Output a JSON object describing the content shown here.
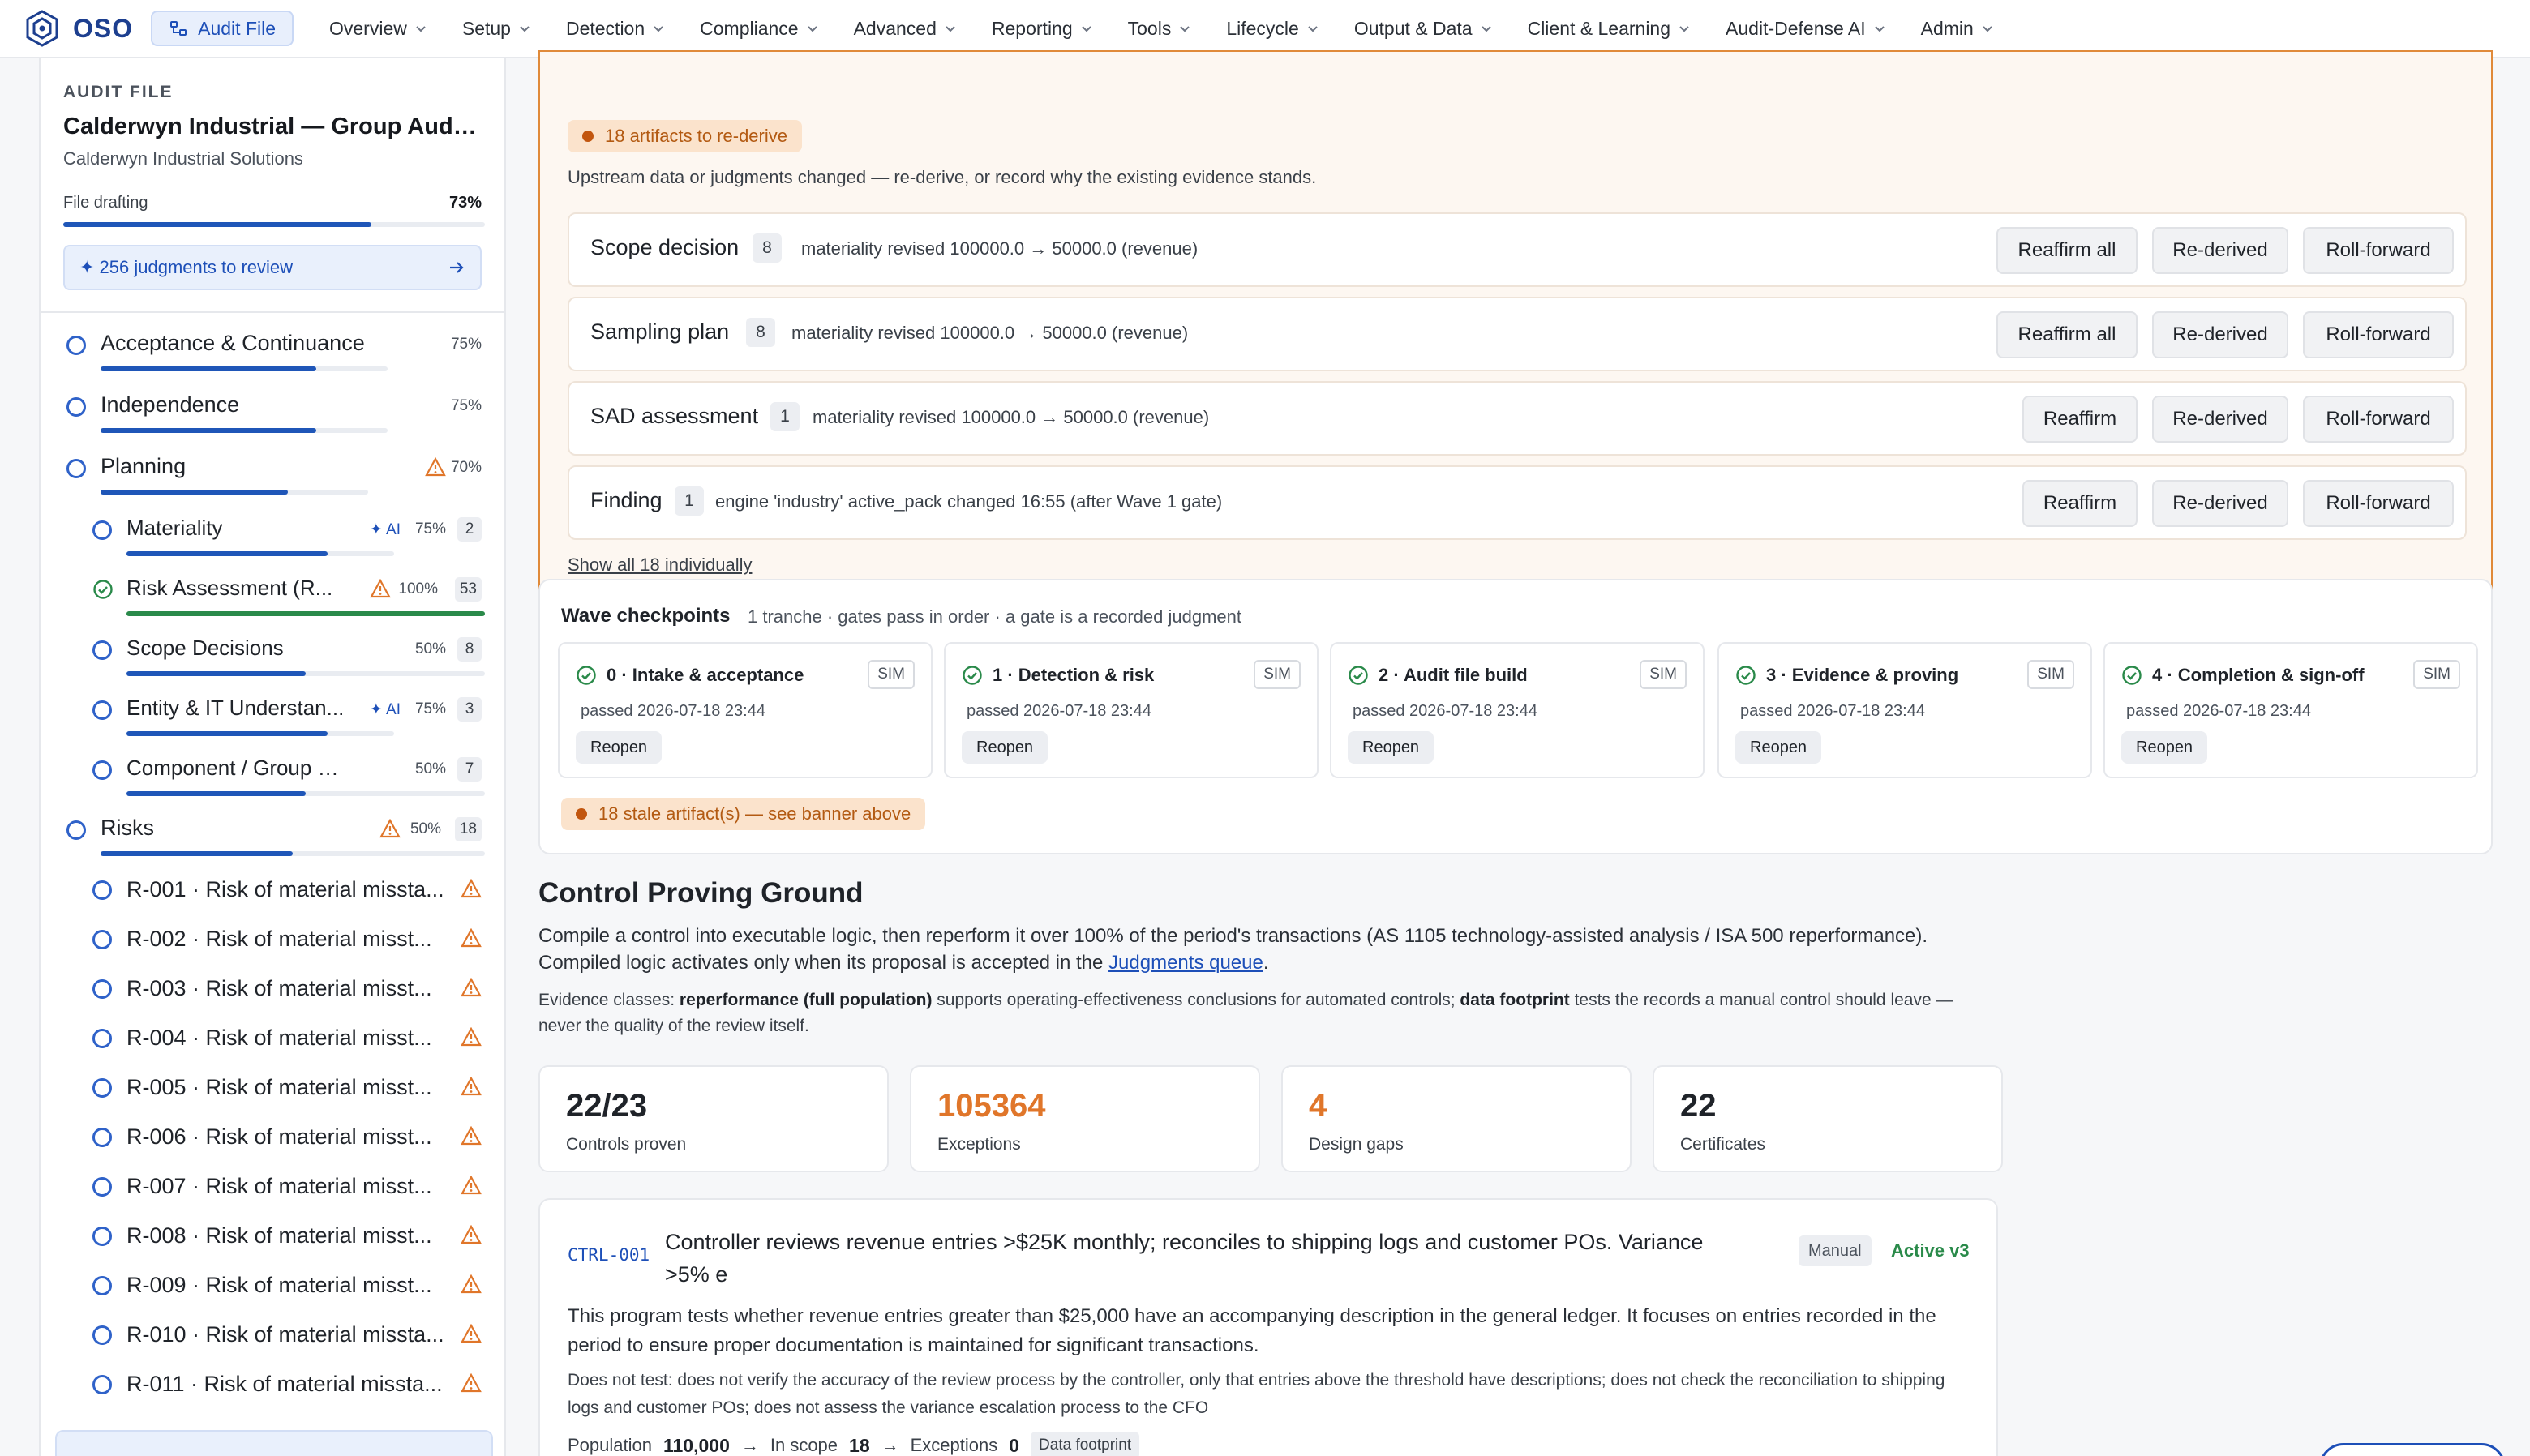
{
  "nav": {
    "logo": "OSO",
    "audit_file": "Audit File",
    "items": [
      "Overview",
      "Setup",
      "Detection",
      "Compliance",
      "Advanced",
      "Reporting",
      "Tools",
      "Lifecycle",
      "Output & Data",
      "Client & Learning",
      "Audit-Defense AI",
      "Admin"
    ]
  },
  "sidebar": {
    "eyebrow": "AUDIT FILE",
    "title": "Calderwyn Industrial — Group Audit...",
    "client": "Calderwyn Industrial Solutions",
    "drafting_label": "File drafting",
    "drafting_pct": "73%",
    "drafting_progress": 0.73,
    "review": "✦ 256 judgments to review",
    "sections": [
      {
        "label": "Acceptance & Continuance",
        "pct": "75%",
        "progress": 0.75
      },
      {
        "label": "Independence",
        "pct": "75%",
        "progress": 0.75
      },
      {
        "label": "Planning",
        "pct": "70%",
        "progress": 0.7
      }
    ],
    "planning_children": [
      {
        "label": "Materiality",
        "ai": "✦ AI",
        "pct": "75%",
        "count": "2",
        "progress": 0.75
      },
      {
        "label": "Risk Assessment (R...",
        "pct": "100%",
        "count": "53",
        "progress": 1.0
      },
      {
        "label": "Scope Decisions",
        "pct": "50%",
        "count": "8",
        "progress": 0.5
      },
      {
        "label": "Entity & IT Understan...",
        "ai": "✦ AI",
        "pct": "75%",
        "count": "3",
        "progress": 0.75
      },
      {
        "label": "Component / Group Scop...",
        "pct": "50%",
        "count": "7",
        "progress": 0.5
      }
    ],
    "risks": {
      "label": "Risks",
      "pct": "50%",
      "count": "18",
      "progress": 0.5
    },
    "risk_items": [
      "R-001 · Risk of material missta...",
      "R-002 · Risk of material misst...",
      "R-003 · Risk of material misst...",
      "R-004 · Risk of material misst...",
      "R-005 · Risk of material misst...",
      "R-006 · Risk of material misst...",
      "R-007 · Risk of material misst...",
      "R-008 · Risk of material misst...",
      "R-009 · Risk of material misst...",
      "R-010 · Risk of material missta...",
      "R-011 · Risk of material missta..."
    ]
  },
  "rederive": {
    "pill": "18 artifacts to re-derive",
    "desc": "Upstream data or judgments changed — re-derive, or record why the existing evidence stands.",
    "items": [
      {
        "name": "Scope decision",
        "count": "8",
        "note": "materiality revised 100000.0 → 50000.0 (revenue)",
        "btn1": "Reaffirm all",
        "btn2": "Re-derived",
        "btn3": "Roll-forward"
      },
      {
        "name": "Sampling plan",
        "count": "8",
        "note": "materiality revised 100000.0 → 50000.0 (revenue)",
        "btn1": "Reaffirm all",
        "btn2": "Re-derived",
        "btn3": "Roll-forward"
      },
      {
        "name": "SAD assessment",
        "count": "1",
        "note": "materiality revised 100000.0 → 50000.0 (revenue)",
        "btn1": "Reaffirm",
        "btn2": "Re-derived",
        "btn3": "Roll-forward"
      },
      {
        "name": "Finding",
        "count": "1",
        "note": "engine 'industry' active_pack changed 16:55 (after Wave 1 gate)",
        "btn1": "Reaffirm",
        "btn2": "Re-derived",
        "btn3": "Roll-forward"
      }
    ],
    "show_all": "Show all 18 individually"
  },
  "waves": {
    "title": "Wave checkpoints",
    "subtitle": "1 tranche · gates pass in order · a gate is a recorded judgment",
    "cards": [
      {
        "name": "0 · Intake & acceptance",
        "sim": "SIM",
        "passed": "passed 2026-07-18 23:44",
        "reopen": "Reopen"
      },
      {
        "name": "1 · Detection & risk",
        "sim": "SIM",
        "passed": "passed 2026-07-18 23:44",
        "reopen": "Reopen"
      },
      {
        "name": "2 · Audit file build",
        "sim": "SIM",
        "passed": "passed 2026-07-18 23:44",
        "reopen": "Reopen"
      },
      {
        "name": "3 · Evidence & proving",
        "sim": "SIM",
        "passed": "passed 2026-07-18 23:44",
        "reopen": "Reopen"
      },
      {
        "name": "4 · Completion & sign-off",
        "sim": "SIM",
        "passed": "passed 2026-07-18 23:44",
        "reopen": "Reopen"
      }
    ],
    "stale": "18 stale artifact(s) — see banner above"
  },
  "cpg": {
    "title": "Control Proving Ground",
    "desc_1": "Compile a control into executable logic, then reperform it over 100% of the period's transactions (AS 1105 technology-assisted analysis / ISA 500 reperformance). Compiled logic activates only when its proposal is accepted in the ",
    "desc_link": "Judgments queue",
    "desc_2": ".",
    "ev_prefix": "Evidence classes: ",
    "ev_b1": "reperformance (full population)",
    "ev_mid": " supports operating-effectiveness conclusions for automated controls; ",
    "ev_b2": "data footprint",
    "ev_end": " tests the records a manual control should leave — never the quality of the review itself.",
    "stats": [
      {
        "value": "22/23",
        "label": "Controls proven"
      },
      {
        "value": "105364",
        "label": "Exceptions"
      },
      {
        "value": "4",
        "label": "Design gaps"
      },
      {
        "value": "22",
        "label": "Certificates"
      }
    ]
  },
  "control": {
    "id": "CTRL-001",
    "title": "Controller reviews revenue entries >$25K monthly; reconciles to shipping logs and customer POs. Variance >5% e",
    "tag": "Manual",
    "status": "Active v3",
    "desc": "This program tests whether revenue entries greater than $25,000 have an accompanying description in the general ledger. It focuses on entries recorded in the period to ensure proper documentation is maintained for significant transactions.",
    "not_test": "Does not test: does not verify the accuracy of the review process by the controller, only that entries above the threshold have descriptions; does not check the reconciliation to shipping logs and customer POs; does not assess the variance escalation process to the CFO",
    "pop_label": "Population",
    "pop_value": "110,000",
    "scope_label": "In scope",
    "scope_value": "18",
    "exc_label": "Exceptions",
    "exc_value": "0",
    "footprint": "Data footprint"
  },
  "colors": {
    "accent": "#1d4fb8",
    "warning": "#e0762a",
    "success": "#2a8a4a",
    "banner_border": "#e08a3a"
  }
}
